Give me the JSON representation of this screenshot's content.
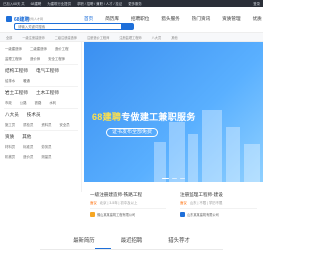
{
  "topbar": {
    "items": [
      "已加入68天 共",
      "68建聘",
      "为建筑行业提供",
      "求职 / 招聘 / 兼职 / 人才 / 挂证",
      "更多服务"
    ],
    "right": "登录"
  },
  "header": {
    "brand": "68建聘",
    "brand_sub": "建筑人才网",
    "nav": [
      "首页",
      "简历库",
      "招聘职位",
      "猎头服务",
      "热门资讯",
      "资质管理",
      "优质"
    ]
  },
  "search": {
    "placeholder": "请输入关键词搜索"
  },
  "category_tabs": [
    "全部",
    "一级注册建造师",
    "二级注册建造师",
    "注册造价工程师",
    "注册监理工程师",
    "八大员",
    "其他"
  ],
  "sidebar": {
    "rows": [
      [
        "一级建造师",
        "二级建造师",
        "造价工程"
      ],
      [
        "监理工程师",
        "造价师",
        "安全工程师"
      ],
      [
        "结构工程师",
        "电气工程师"
      ],
      [
        "给排水",
        "暖通"
      ],
      [
        "岩土工程师",
        "土木工程师"
      ],
      [
        "市政",
        "公路",
        "铁路",
        "水利"
      ],
      [
        "八大员",
        "技术员"
      ],
      [
        "施工员",
        "质检员",
        "资料员",
        "安全员"
      ],
      [
        "资质",
        "其他"
      ],
      [
        "材料员",
        "标准员",
        "劳务员"
      ],
      [
        "机械员",
        "造价员",
        "测量员"
      ]
    ]
  },
  "banner": {
    "title_prefix": "68建聘",
    "title_main": "专做建工兼职服务",
    "pill": "证书发布全部免费"
  },
  "cards": [
    {
      "title": "一级注册建造师-铁路工程",
      "salary": "面议",
      "meta": "北京 | 3-5年 | 初中及以上",
      "company": "佛山某某建筑工程有限公司"
    },
    {
      "title": "注册监理工程师-建设",
      "salary": "面议",
      "meta": "山东 | 不限 | 学历不限",
      "company": "山东某某建筑有限公司"
    }
  ],
  "bottom_tabs": [
    "最新简历",
    "最近招聘",
    "猎头荐才"
  ],
  "colors": {
    "accent": "#1e6fd9",
    "banner_highlight": "#ffe14a",
    "salary": "#ff6a00"
  }
}
